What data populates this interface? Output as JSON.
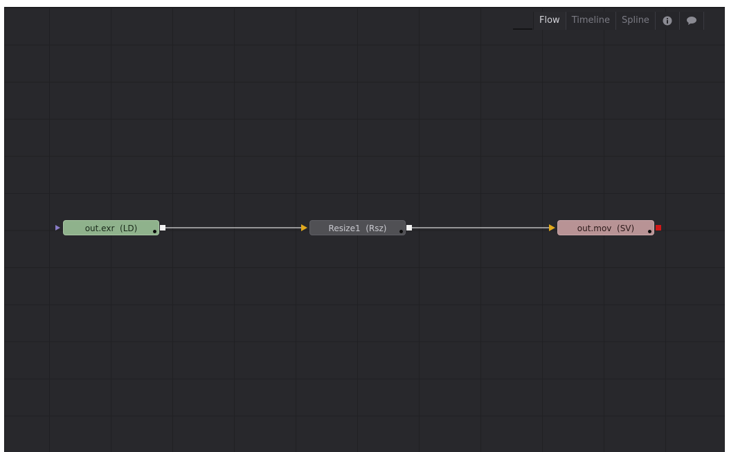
{
  "view_tabs": [
    {
      "label": "Flow",
      "active": true
    },
    {
      "label": "Timeline",
      "active": false
    },
    {
      "label": "Spline",
      "active": false
    }
  ],
  "icon_tabs": [
    {
      "icon": "info-icon"
    },
    {
      "icon": "comment-icon"
    }
  ],
  "nodes": {
    "loader": {
      "label": "out.exr  (LD)",
      "color": "#8fb28c"
    },
    "resize": {
      "label": "Resize1  (Rsz)",
      "color": "#505054"
    },
    "saver": {
      "label": "out.mov  (SV)",
      "color": "#b89395"
    }
  },
  "colors": {
    "canvas_bg": "#28282c",
    "connection": "#d8d8d8",
    "input_arrow": "#e0a81c",
    "loader_input_arrow": "#8a7cc8",
    "saver_output_port": "#d01818"
  }
}
